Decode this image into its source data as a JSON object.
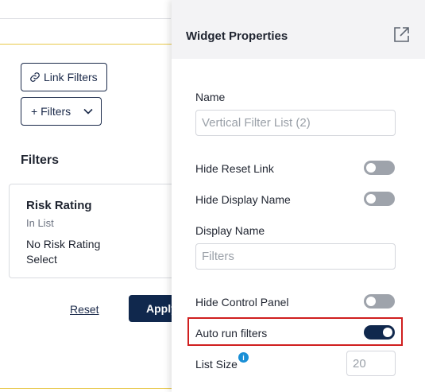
{
  "canvas": {
    "link_filters_label": "Link Filters",
    "add_filters_label": "+ Filters",
    "filters_heading": "Filters",
    "filter_card": {
      "title": "Risk Rating",
      "operator": "In List",
      "value": "No Risk Rating",
      "select_label": "Select"
    },
    "reset_label": "Reset",
    "apply_label": "Apply"
  },
  "panel": {
    "title": "Widget Properties",
    "name_label": "Name",
    "name_placeholder": "Vertical Filter List (2)",
    "hide_reset_link_label": "Hide Reset Link",
    "hide_reset_link_on": false,
    "hide_display_name_label": "Hide Display Name",
    "hide_display_name_on": false,
    "display_name_label": "Display Name",
    "display_name_placeholder": "Filters",
    "hide_control_panel_label": "Hide Control Panel",
    "hide_control_panel_on": false,
    "auto_run_filters_label": "Auto run filters",
    "auto_run_filters_on": true,
    "list_size_label": "List Size",
    "list_size_value": "20"
  },
  "colors": {
    "primary": "#10284d",
    "highlight": "#d01f1f",
    "info": "#1a8fd6",
    "widget_border": "#e8c84a"
  },
  "icons": [
    "link-icon",
    "chevron-down-icon",
    "popout-icon",
    "info-icon"
  ]
}
